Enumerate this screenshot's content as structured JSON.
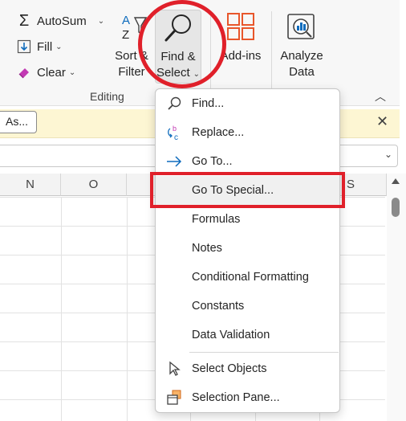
{
  "ribbon": {
    "autosum_label": "AutoSum",
    "fill_label": "Fill",
    "clear_label": "Clear",
    "sort_filter_label_1": "Sort &",
    "sort_filter_label_2": "Filter",
    "find_select_label_1": "Find &",
    "find_select_label_2": "Select",
    "addins_label": "Add-ins",
    "analyze_label_1": "Analyze",
    "analyze_label_2": "Data",
    "group_editing": "Editing"
  },
  "infobar": {
    "saveas_label": "As...",
    "close_glyph": "✕"
  },
  "grid": {
    "columns": [
      "N",
      "O",
      "S"
    ]
  },
  "menu": {
    "find": "Find...",
    "replace": "Replace...",
    "goto": "Go To...",
    "goto_special": "Go To Special...",
    "formulas": "Formulas",
    "notes": "Notes",
    "conditional_formatting": "Conditional Formatting",
    "constants": "Constants",
    "data_validation": "Data Validation",
    "select_objects": "Select Objects",
    "selection_pane": "Selection Pane..."
  },
  "colors": {
    "accent": "#0f6cbd",
    "annotation": "#e0202a",
    "addins_orange": "#e8562b",
    "infobar_bg": "#fdf6d3"
  }
}
